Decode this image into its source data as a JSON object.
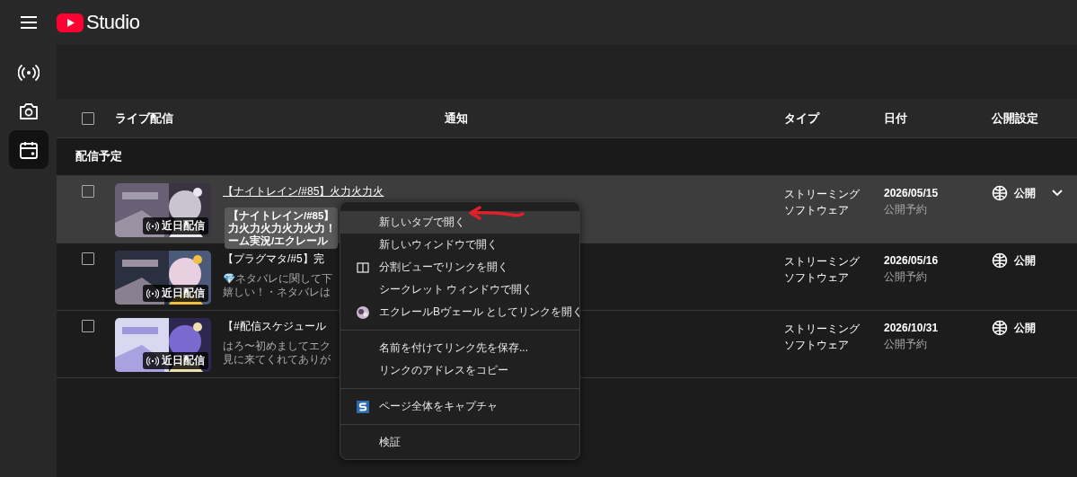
{
  "app": {
    "title": "Studio"
  },
  "sidebar": {
    "items": [
      {
        "kind": "live",
        "selected": false
      },
      {
        "kind": "camera",
        "selected": false
      },
      {
        "kind": "calendar",
        "selected": true
      }
    ]
  },
  "table": {
    "header_checked": false,
    "columns": [
      "ライブ配信",
      "通知",
      "タイプ",
      "日付",
      "公開設定"
    ],
    "section": "配信予定",
    "rows": [
      {
        "checked": false,
        "hovered": true,
        "badge": "近日配信",
        "title": "【ナイトレイン/#85】火力火力火",
        "description": [],
        "type": [
          "ストリーミング",
          "ソフトウェア"
        ],
        "date": "2026/05/15",
        "status": "公開予約",
        "visibility": "公開",
        "dropdown": true
      },
      {
        "checked": false,
        "hovered": false,
        "badge": "近日配信",
        "title": "【プラグマタ/#5】完",
        "description": [
          "💎ネタバレに関して下",
          "嬉しい！・ネタバレは"
        ],
        "type": [
          "ストリーミング",
          "ソフトウェア"
        ],
        "date": "2026/05/16",
        "status": "公開予約",
        "visibility": "公開",
        "dropdown": false
      },
      {
        "checked": false,
        "hovered": false,
        "badge": "近日配信",
        "title": "【#配信スケジュール",
        "description": [
          "はろ〜初めましてエク",
          "見に来てくれてありが"
        ],
        "type": [
          "ストリーミング",
          "ソフトウェア"
        ],
        "date": "2026/10/31",
        "status": "公開予約",
        "visibility": "公開",
        "dropdown": false
      }
    ]
  },
  "tooltip": {
    "lines": [
      "【ナイトレイン/#85】",
      "力火力火力火力火力！",
      "ーム実況/エクレール"
    ]
  },
  "context_menu": {
    "groups": [
      [
        {
          "label": "新しいタブで開く",
          "kind": "plain",
          "selected": true
        },
        {
          "label": "新しいウィンドウで開く",
          "kind": "plain",
          "selected": false
        },
        {
          "label": "分割ビューでリンクを開く",
          "kind": "split",
          "selected": false
        },
        {
          "label": "シークレット ウィンドウで開く",
          "kind": "plain",
          "selected": false
        },
        {
          "label": "エクレールBヴェール としてリンクを開く",
          "kind": "profile",
          "selected": false
        }
      ],
      [
        {
          "label": "名前を付けてリンク先を保存...",
          "kind": "plain",
          "selected": false
        },
        {
          "label": "リンクのアドレスをコピー",
          "kind": "plain",
          "selected": false
        }
      ],
      [
        {
          "label": "ページ全体をキャプチャ",
          "kind": "capture",
          "selected": false
        }
      ],
      [
        {
          "label": "検証",
          "kind": "plain",
          "selected": false
        }
      ]
    ]
  }
}
